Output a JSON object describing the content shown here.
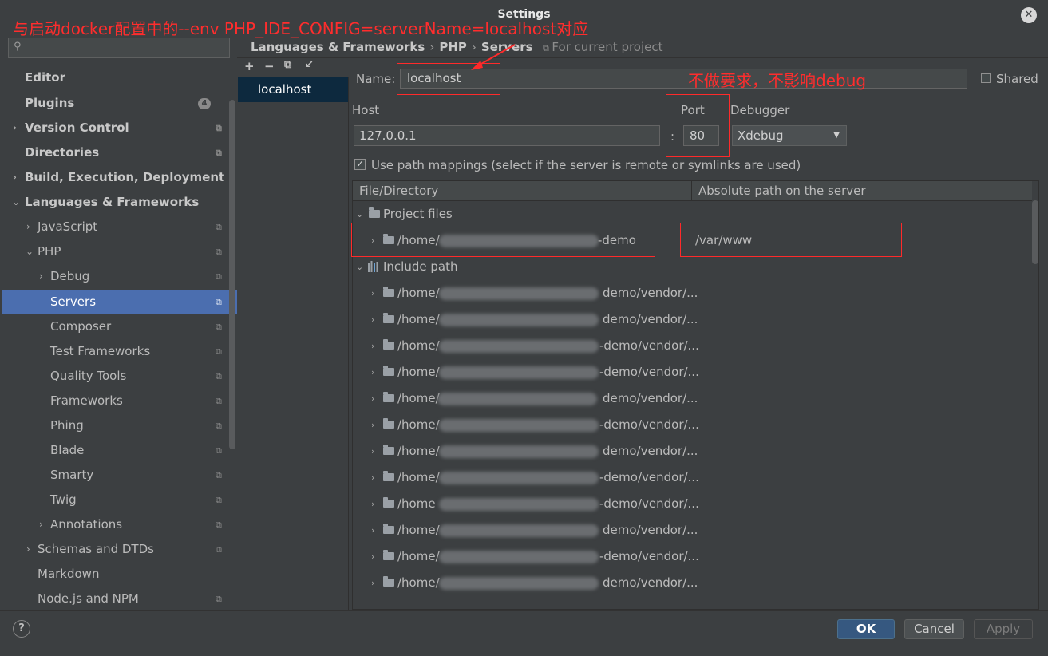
{
  "window": {
    "title": "Settings"
  },
  "annotations": {
    "top": "与启动docker配置中的--env PHP_IDE_CONFIG=serverName=localhost对应",
    "name": "不做要求，不影响debug"
  },
  "sidebar": {
    "search_placeholder": "",
    "plugins_badge": "4",
    "items": [
      {
        "label": "Editor"
      },
      {
        "label": "Plugins"
      },
      {
        "label": "Version Control"
      },
      {
        "label": "Directories"
      },
      {
        "label": "Build, Execution, Deployment"
      },
      {
        "label": "Languages & Frameworks"
      },
      {
        "label": "JavaScript"
      },
      {
        "label": "PHP"
      },
      {
        "label": "Debug"
      },
      {
        "label": "Servers"
      },
      {
        "label": "Composer"
      },
      {
        "label": "Test Frameworks"
      },
      {
        "label": "Quality Tools"
      },
      {
        "label": "Frameworks"
      },
      {
        "label": "Phing"
      },
      {
        "label": "Blade"
      },
      {
        "label": "Smarty"
      },
      {
        "label": "Twig"
      },
      {
        "label": "Annotations"
      },
      {
        "label": "Schemas and DTDs"
      },
      {
        "label": "Markdown"
      },
      {
        "label": "Node.js and NPM"
      }
    ]
  },
  "breadcrumb": {
    "items": [
      "Languages & Frameworks",
      "PHP",
      "Servers"
    ],
    "scope": "For current project"
  },
  "servers": {
    "toolbar": [
      "+",
      "−",
      "⧉",
      "↙"
    ],
    "list": [
      "localhost"
    ]
  },
  "form": {
    "name_label": "Name:",
    "name_value": "localhost",
    "shared_label": "Shared",
    "host_label": "Host",
    "host_value": "127.0.0.1",
    "port_label": "Port",
    "port_colon": ":",
    "port_value": "80",
    "debugger_label": "Debugger",
    "debugger_value": "Xdebug",
    "path_mappings_label": "Use path mappings (select if the server is remote or symlinks are used)",
    "path_mappings_checked": true
  },
  "mappings": {
    "col_file": "File/Directory",
    "col_server": "Absolute path on the server",
    "project_files_label": "Project files",
    "project_row": {
      "prefix": "/home/",
      "suffix": "-demo",
      "server_path": "/var/www"
    },
    "include_path_label": "Include path",
    "include_rows": [
      {
        "prefix": "/home/",
        "suffix": "demo/vendor/..."
      },
      {
        "prefix": "/home/",
        "suffix": "demo/vendor/..."
      },
      {
        "prefix": "/home/",
        "suffix": "-demo/vendor/..."
      },
      {
        "prefix": "/home/",
        "suffix": "-demo/vendor/..."
      },
      {
        "prefix": "/home/",
        "suffix": "demo/vendor/..."
      },
      {
        "prefix": "/home/",
        "suffix": "-demo/vendor/..."
      },
      {
        "prefix": "/home/",
        "suffix": "demo/vendor/..."
      },
      {
        "prefix": "/home/",
        "suffix": "-demo/vendor/..."
      },
      {
        "prefix": "/home",
        "suffix": "-demo/vendor/..."
      },
      {
        "prefix": "/home/",
        "suffix": "demo/vendor/..."
      },
      {
        "prefix": "/home/",
        "suffix": "-demo/vendor/..."
      },
      {
        "prefix": "/home/",
        "suffix": "demo/vendor/..."
      }
    ]
  },
  "footer": {
    "help": "?",
    "ok": "OK",
    "cancel": "Cancel",
    "apply": "Apply"
  },
  "colors": {
    "background": "#3c3f41",
    "selection": "#4b6eaf",
    "annotation": "#ff2d2d",
    "ok_button": "#365880"
  }
}
